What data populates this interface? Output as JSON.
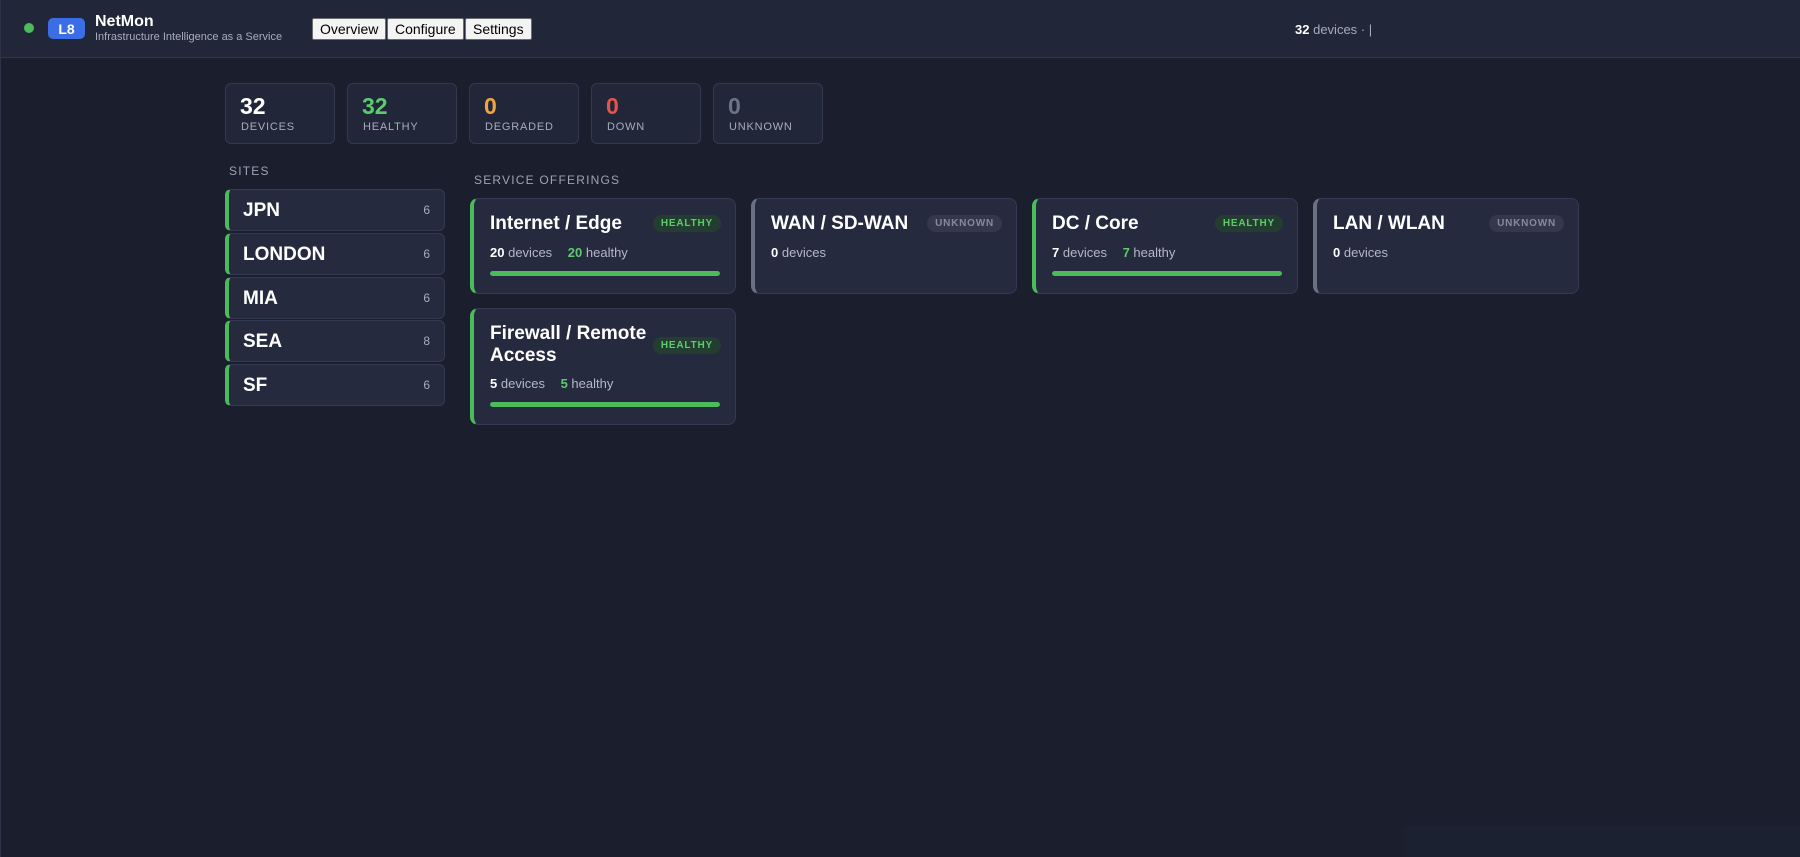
{
  "app": {
    "logo": "L8",
    "name": "NetMon",
    "subtitle": "Infrastructure Intelligence as a Service",
    "status_color": "#4cbb5c"
  },
  "nav": [
    {
      "label": "Overview"
    },
    {
      "label": "Configure"
    },
    {
      "label": "Settings"
    }
  ],
  "summary": {
    "device_count": "32",
    "device_text": "devices · |"
  },
  "stats": [
    {
      "value": "32",
      "label": "DEVICES",
      "color": "#ffffff"
    },
    {
      "value": "32",
      "label": "HEALTHY",
      "color": "#5ccc6b"
    },
    {
      "value": "0",
      "label": "DEGRADED",
      "color": "#f0a640"
    },
    {
      "value": "0",
      "label": "DOWN",
      "color": "#e5534b"
    },
    {
      "value": "0",
      "label": "UNKNOWN",
      "color": "#6e7387"
    }
  ],
  "sites_label": "SITES",
  "sites": [
    {
      "name": "JPN",
      "count": "6"
    },
    {
      "name": "LONDON",
      "count": "6"
    },
    {
      "name": "MIA",
      "count": "6"
    },
    {
      "name": "SEA",
      "count": "8"
    },
    {
      "name": "SF",
      "count": "6"
    }
  ],
  "services_label": "SERVICE OFFERINGS",
  "services": [
    {
      "title": "Internet / Edge",
      "status": "HEALTHY",
      "devices": "20",
      "devices_label": "devices",
      "healthy": "20",
      "healthy_label": "healthy",
      "health_fraction": 1.0
    },
    {
      "title": "WAN / SD-WAN",
      "status": "UNKNOWN",
      "devices": "0",
      "devices_label": "devices"
    },
    {
      "title": "DC / Core",
      "status": "HEALTHY",
      "devices": "7",
      "devices_label": "devices",
      "healthy": "7",
      "healthy_label": "healthy",
      "health_fraction": 1.0
    },
    {
      "title": "LAN / WLAN",
      "status": "UNKNOWN",
      "devices": "0",
      "devices_label": "devices"
    },
    {
      "title": "Firewall / Remote Access",
      "status": "HEALTHY",
      "devices": "5",
      "devices_label": "devices",
      "healthy": "5",
      "healthy_label": "healthy",
      "health_fraction": 1.0
    }
  ],
  "colors": {
    "background": "#1b1e2c",
    "healthy": "#4cbb5c",
    "accent": "#3b6ee6"
  }
}
